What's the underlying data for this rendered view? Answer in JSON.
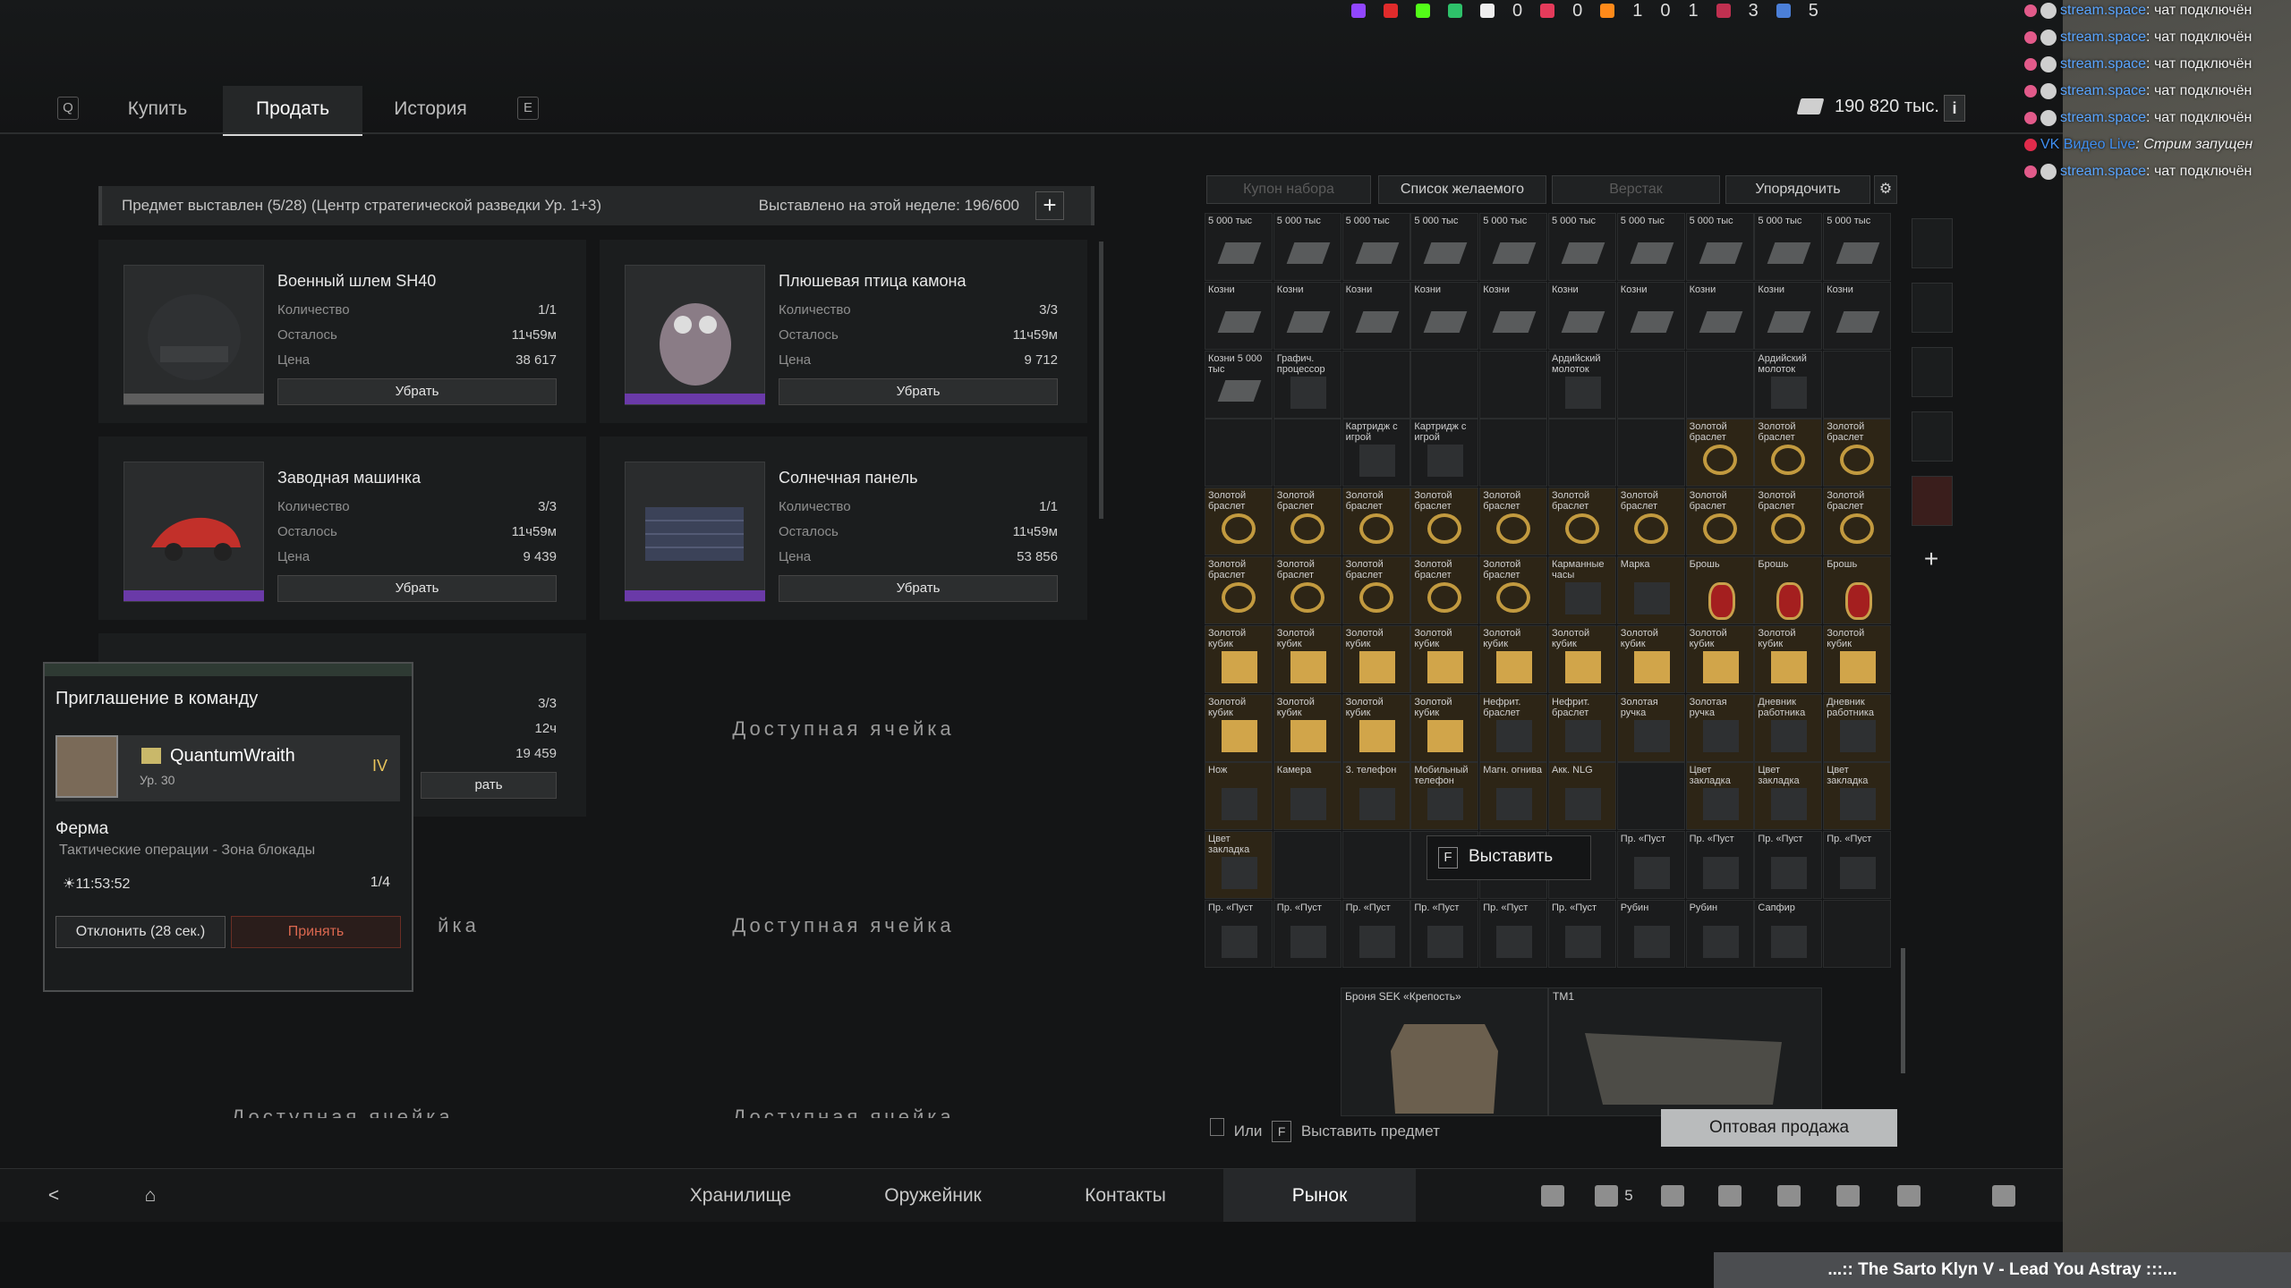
{
  "tabs": {
    "left_key": "Q",
    "buy": "Купить",
    "sell": "Продать",
    "history": "История",
    "right_key": "E"
  },
  "balance": "190 820 тыс.",
  "info": "i",
  "social_counts": [
    "0",
    "0",
    "1",
    "0",
    "1",
    "3",
    "5"
  ],
  "status": {
    "left": "Предмет выставлен (5/28)  (Центр стратегической разведки Ур. 1+3)",
    "right": "Выставлено на этой неделе: 196/600",
    "plus": "+"
  },
  "offer_labels": {
    "qty": "Количество",
    "left": "Осталось",
    "price": "Цена",
    "remove": "Убрать"
  },
  "offers": [
    {
      "title": "Военный шлем SH40",
      "qty": "1/1",
      "left": "11ч59м",
      "price": "38 617",
      "rarity": "#5e5e5e"
    },
    {
      "title": "Плюшевая птица камона",
      "qty": "3/3",
      "left": "11ч59м",
      "price": "9 712",
      "rarity": "#6a3aa8"
    },
    {
      "title": "Заводная машинка",
      "qty": "3/3",
      "left": "11ч59м",
      "price": "9 439",
      "rarity": "#6a3aa8"
    },
    {
      "title": "Солнечная панель",
      "qty": "1/1",
      "left": "11ч59м",
      "price": "53 856",
      "rarity": "#6a3aa8"
    },
    {
      "title": "",
      "qty": "3/3",
      "left": "12ч",
      "price": "19 459",
      "rarity": "#6a3aa8"
    }
  ],
  "empty_slot": "Доступная ячейка",
  "invite": {
    "header": "Приглашение в команду",
    "player": "QuantumWraith",
    "level": "Ур. 30",
    "rank": "IV",
    "mode": "Ферма",
    "subtitle": "Тактические операции - Зона блокады",
    "time": "11:53:52",
    "count": "1/4",
    "decline": "Отклонить (28 сек.)",
    "accept": "Принять",
    "remove_partial": "рать",
    "empty_partial": "йка"
  },
  "stash_tabs": {
    "coupon": "Купон набора",
    "wishlist": "Список желаемого",
    "workbench": "Верстак",
    "sort": "Упорядочить"
  },
  "cells": [
    "5 000 тыс",
    "5 000 тыс",
    "5 000 тыс",
    "5 000 тыс",
    "5 000 тыс",
    "5 000 тыс",
    "5 000 тыс",
    "5 000 тыс",
    "5 000 тыс",
    "5 000 тыс",
    "Козни",
    "Козни",
    "Козни",
    "Козни",
    "Козни",
    "Козни",
    "Козни",
    "Козни",
    "Козни",
    "Козни",
    "Козни 5 000 тыс",
    "Графич. процессор",
    "",
    "",
    "",
    "Ардийский молоток",
    "",
    "",
    "Ардийский молоток",
    "",
    "",
    "",
    "Картридж с игрой",
    "Картридж с игрой",
    "",
    "",
    "",
    "Золотой браслет",
    "Золотой браслет",
    "Золотой браслет",
    "Золотой браслет",
    "Золотой браслет",
    "Золотой браслет",
    "Золотой браслет",
    "Золотой браслет",
    "Золотой браслет",
    "Золотой браслет",
    "Золотой браслет",
    "Золотой браслет",
    "Золотой браслет",
    "Золотой браслет",
    "Золотой браслет",
    "Золотой браслет",
    "Золотой браслет",
    "Золотой браслет",
    "Карманные часы",
    "Марка",
    "Брошь",
    "Брошь",
    "Брошь",
    "Золотой кубик",
    "Золотой кубик",
    "Золотой кубик",
    "Золотой кубик",
    "Золотой кубик",
    "Золотой кубик",
    "Золотой кубик",
    "Золотой кубик",
    "Золотой кубик",
    "Золотой кубик",
    "Золотой кубик",
    "Золотой кубик",
    "Золотой кубик",
    "Золотой кубик",
    "Нефрит. браслет",
    "Нефрит. браслет",
    "Золотая ручка",
    "Золотая ручка",
    "Дневник работника",
    "Дневник работника",
    "Нож",
    "Камера",
    "3. телефон",
    "Мобильный телефон",
    "Магн. огнива",
    "Акк. NLG",
    "",
    "Цвет закладка",
    "Цвет закладка",
    "Цвет закладка",
    "Цвет закладка",
    "",
    "",
    "",
    "",
    "",
    "Пр. «Пуст",
    "Пр. «Пуст",
    "Пр. «Пуст",
    "Пр. «Пуст",
    "Пр. «Пуст",
    "Пр. «Пуст",
    "Пр. «Пуст",
    "Пр. «Пуст",
    "Пр. «Пуст",
    "Пр. «Пуст",
    "Рубин",
    "Рубин",
    "Сапфир",
    ""
  ],
  "big_items": {
    "armor": "Броня SEK «Крепость»",
    "tm1": "TM1"
  },
  "context_menu": {
    "key": "F",
    "label": "Выставить"
  },
  "hint": {
    "or": "Или",
    "key": "F",
    "text": "Выставить предмет"
  },
  "bulk_sell": "Оптовая продажа",
  "bottom_nav": {
    "storage": "Хранилище",
    "armory": "Оружейник",
    "contacts": "Контакты",
    "market": "Рынок",
    "friends_count": "5"
  },
  "chat": [
    {
      "user": "stream.space",
      "msg": ": чат подключён"
    },
    {
      "user": "stream.space",
      "msg": ": чат подключён"
    },
    {
      "user": "stream.space",
      "msg": ": чат подключён"
    },
    {
      "user": "stream.space",
      "msg": ": чат подключён"
    },
    {
      "user": "stream.space",
      "msg": ": чат подключён"
    },
    {
      "user": "VK Видео Live",
      "msg": ": Стрим запущен"
    },
    {
      "user": "stream.space",
      "msg": ": чат подключён"
    }
  ],
  "now_playing": "...:: The Sarto Klyn V - Lead You Astray :::..."
}
